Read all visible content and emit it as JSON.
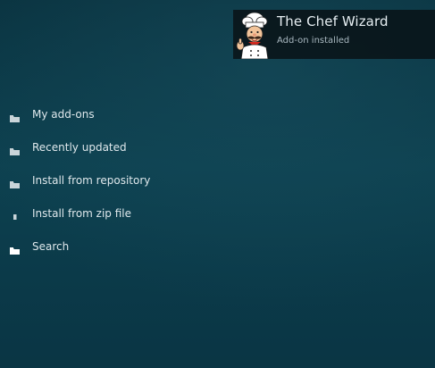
{
  "notification": {
    "title": "The Chef Wizard",
    "subtitle": "Add-on installed",
    "icon": "chef-icon"
  },
  "menu": {
    "items": [
      {
        "label": "My add-ons",
        "icon": "folder-icon"
      },
      {
        "label": "Recently updated",
        "icon": "folder-icon"
      },
      {
        "label": "Install from repository",
        "icon": "folder-icon"
      },
      {
        "label": "Install from zip file",
        "icon": "file-icon"
      },
      {
        "label": "Search",
        "icon": "folder-open-icon"
      }
    ]
  },
  "colors": {
    "background": "#0d4150",
    "toast_background": "#0a161c",
    "text": "#dfe8ec",
    "subtext": "#a9b8c0"
  }
}
